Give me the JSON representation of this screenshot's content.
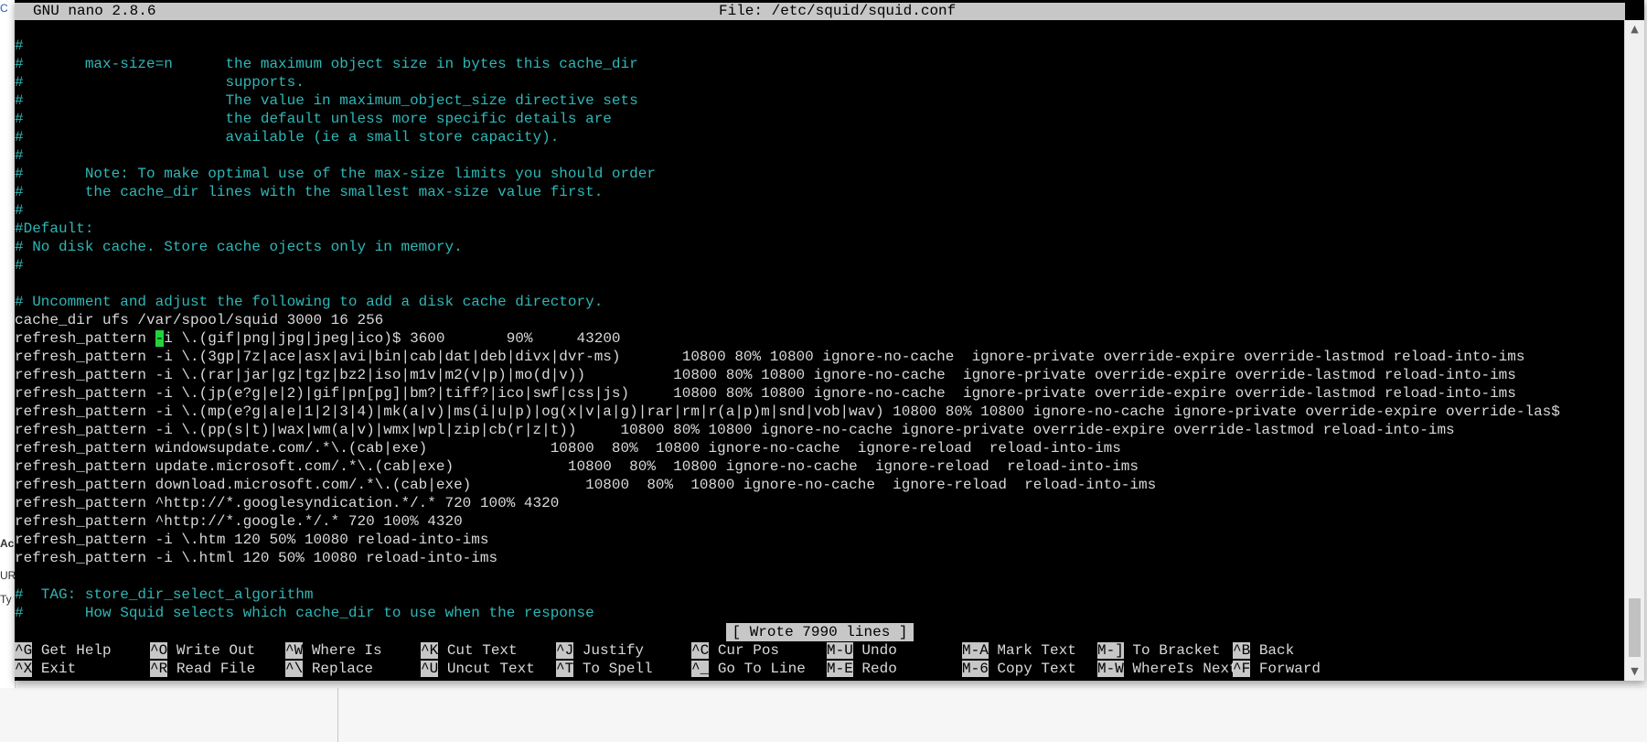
{
  "window": {
    "app": "GNU nano 2.8.6",
    "file": "File: /etc/squid/squid.conf"
  },
  "editor": {
    "lines": [
      {
        "text": "#",
        "type": "comment"
      },
      {
        "text": "#       max-size=n      the maximum object size in bytes this cache_dir",
        "type": "comment"
      },
      {
        "text": "#                       supports.",
        "type": "comment"
      },
      {
        "text": "#                       The value in maximum_object_size directive sets",
        "type": "comment"
      },
      {
        "text": "#                       the default unless more specific details are",
        "type": "comment"
      },
      {
        "text": "#                       available (ie a small store capacity).",
        "type": "comment"
      },
      {
        "text": "#",
        "type": "comment"
      },
      {
        "text": "#       Note: To make optimal use of the max-size limits you should order",
        "type": "comment"
      },
      {
        "text": "#       the cache_dir lines with the smallest max-size value first.",
        "type": "comment"
      },
      {
        "text": "#",
        "type": "comment"
      },
      {
        "text": "#Default:",
        "type": "comment"
      },
      {
        "text": "# No disk cache. Store cache ojects only in memory.",
        "type": "comment"
      },
      {
        "text": "#",
        "type": "comment"
      },
      {
        "text": "",
        "type": "text"
      },
      {
        "text": "# Uncomment and adjust the following to add a disk cache directory.",
        "type": "comment"
      },
      {
        "text": "cache_dir ufs /var/spool/squid 3000 16 256",
        "type": "text"
      },
      {
        "text": "refresh_pattern -i \\.(gif|png|jpg|jpeg|ico)$ 3600       90%     43200",
        "type": "text",
        "cursor_at": 16
      },
      {
        "text": "refresh_pattern -i \\.(3gp|7z|ace|asx|avi|bin|cab|dat|deb|divx|dvr-ms)       10800 80% 10800 ignore-no-cache  ignore-private override-expire override-lastmod reload-into-ims",
        "type": "text"
      },
      {
        "text": "refresh_pattern -i \\.(rar|jar|gz|tgz|bz2|iso|m1v|m2(v|p)|mo(d|v))          10800 80% 10800 ignore-no-cache  ignore-private override-expire override-lastmod reload-into-ims",
        "type": "text"
      },
      {
        "text": "refresh_pattern -i \\.(jp(e?g|e|2)|gif|pn[pg]|bm?|tiff?|ico|swf|css|js)     10800 80% 10800 ignore-no-cache  ignore-private override-expire override-lastmod reload-into-ims",
        "type": "text"
      },
      {
        "text": "refresh_pattern -i \\.(mp(e?g|a|e|1|2|3|4)|mk(a|v)|ms(i|u|p)|og(x|v|a|g)|rar|rm|r(a|p)m|snd|vob|wav) 10800 80% 10800 ignore-no-cache ignore-private override-expire override-las$",
        "type": "text"
      },
      {
        "text": "refresh_pattern -i \\.(pp(s|t)|wax|wm(a|v)|wmx|wpl|zip|cb(r|z|t))     10800 80% 10800 ignore-no-cache ignore-private override-expire override-lastmod reload-into-ims",
        "type": "text"
      },
      {
        "text": "refresh_pattern windowsupdate.com/.*\\.(cab|exe)              10800  80%  10800 ignore-no-cache  ignore-reload  reload-into-ims",
        "type": "text"
      },
      {
        "text": "refresh_pattern update.microsoft.com/.*\\.(cab|exe)             10800  80%  10800 ignore-no-cache  ignore-reload  reload-into-ims",
        "type": "text"
      },
      {
        "text": "refresh_pattern download.microsoft.com/.*\\.(cab|exe)             10800  80%  10800 ignore-no-cache  ignore-reload  reload-into-ims",
        "type": "text"
      },
      {
        "text": "refresh_pattern ^http://*.googlesyndication.*/.* 720 100% 4320",
        "type": "text"
      },
      {
        "text": "refresh_pattern ^http://*.google.*/.* 720 100% 4320",
        "type": "text"
      },
      {
        "text": "refresh_pattern -i \\.htm 120 50% 10080 reload-into-ims",
        "type": "text"
      },
      {
        "text": "refresh_pattern -i \\.html 120 50% 10080 reload-into-ims",
        "type": "text"
      },
      {
        "text": "",
        "type": "text"
      },
      {
        "text": "#  TAG: store_dir_select_algorithm",
        "type": "comment"
      },
      {
        "text": "#       How Squid selects which cache_dir to use when the response",
        "type": "comment"
      }
    ]
  },
  "status": "[ Wrote 7990 lines ]",
  "shortcuts": {
    "row1": [
      {
        "key": "^G",
        "label": "Get Help"
      },
      {
        "key": "^O",
        "label": "Write Out"
      },
      {
        "key": "^W",
        "label": "Where Is"
      },
      {
        "key": "^K",
        "label": "Cut Text"
      },
      {
        "key": "^J",
        "label": "Justify"
      },
      {
        "key": "^C",
        "label": "Cur Pos"
      },
      {
        "key": "M-U",
        "label": "Undo"
      },
      {
        "key": "M-A",
        "label": "Mark Text"
      },
      {
        "key": "M-]",
        "label": "To Bracket"
      },
      {
        "key": "^B",
        "label": "Back"
      }
    ],
    "row2": [
      {
        "key": "^X",
        "label": "Exit"
      },
      {
        "key": "^R",
        "label": "Read File"
      },
      {
        "key": "^\\",
        "label": "Replace"
      },
      {
        "key": "^U",
        "label": "Uncut Text"
      },
      {
        "key": "^T",
        "label": "To Spell"
      },
      {
        "key": "^_",
        "label": "Go To Line"
      },
      {
        "key": "M-E",
        "label": "Redo"
      },
      {
        "key": "M-6",
        "label": "Copy Text"
      },
      {
        "key": "M-W",
        "label": "WhereIs Next"
      },
      {
        "key": "^F",
        "label": "Forward"
      }
    ]
  },
  "background_fragments": {
    "top_left": "C",
    "mid_left_1": "UR",
    "mid_left_2": "Ty",
    "mid_left_3": "Ac"
  },
  "colors": {
    "terminal_bg": "#000000",
    "comment_text": "#2fb7b7",
    "normal_text": "#d9d9d9",
    "inverse_bar": "#c7c7c7",
    "cursor": "#22d33b"
  },
  "icons": {
    "scroll_up": "▲",
    "scroll_down": "▼"
  }
}
